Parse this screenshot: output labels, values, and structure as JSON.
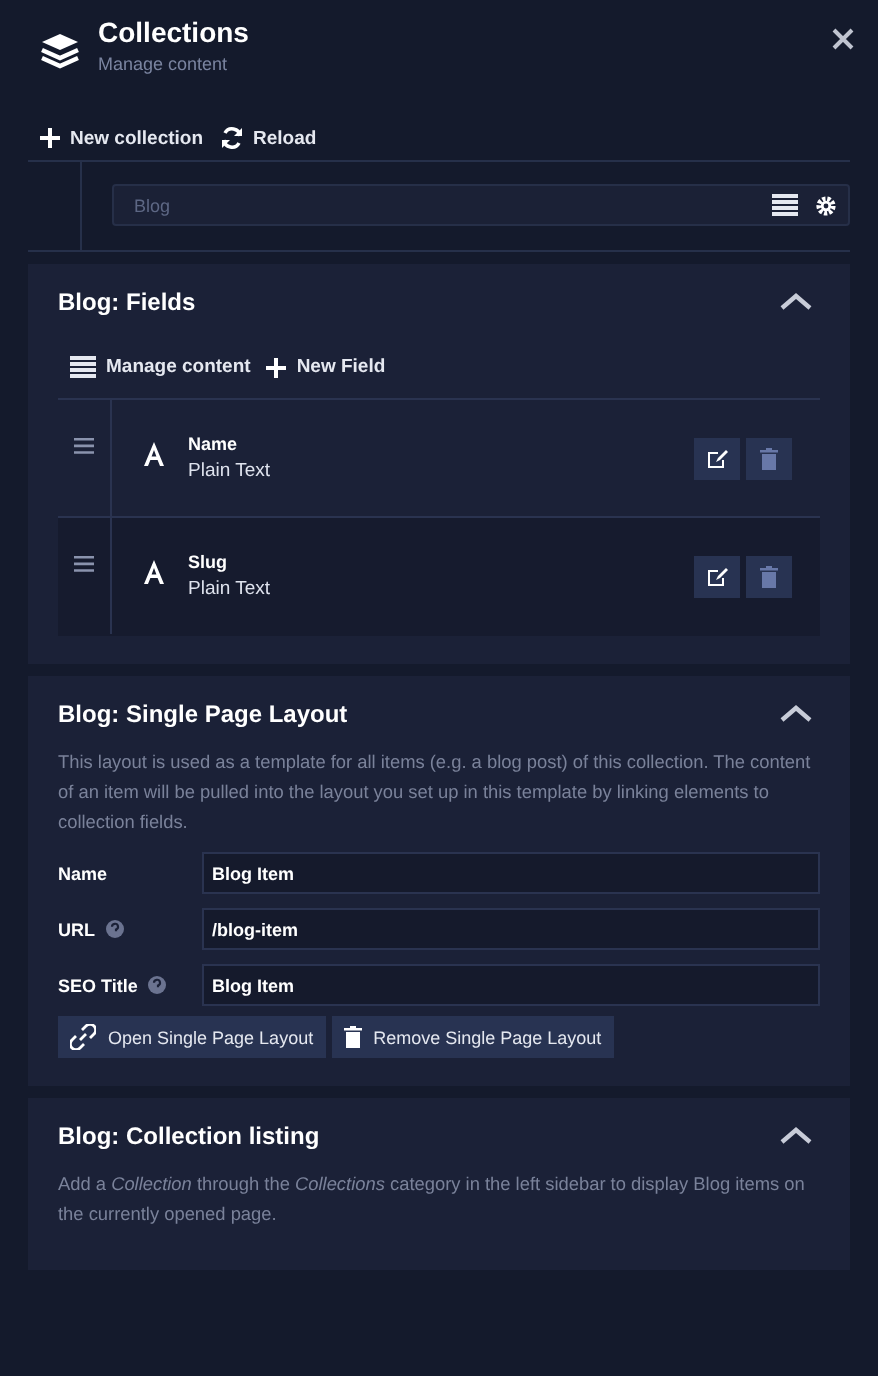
{
  "header": {
    "title": "Collections",
    "subtitle": "Manage content"
  },
  "toolbar": [
    "New collection",
    "Reload"
  ],
  "collection": {
    "placeholder": "Blog"
  },
  "sections": [
    {
      "kind": "fields",
      "title": "Blog: Fields",
      "expanded": true,
      "actions": [
        "Manage content",
        "New Field"
      ],
      "fields": [
        {
          "name": "Name",
          "type": "Plain Text"
        },
        {
          "name": "Slug",
          "type": "Plain Text"
        }
      ]
    },
    {
      "kind": "layout",
      "title": "Blog: Single Page Layout",
      "expanded": true,
      "description": "This layout is used as a template for all items (e.g. a blog post) of this collection. The content of an item will be pulled into the layout you set up in this template by linking elements to collection fields.",
      "form": [
        {
          "label": "Name",
          "help": false,
          "value": "Blog Item"
        },
        {
          "label": "URL",
          "help": true,
          "value": "/blog-item"
        },
        {
          "label": "SEO Title",
          "help": true,
          "value": "Blog Item"
        }
      ],
      "buttons": [
        "Open Single Page Layout",
        "Remove Single Page Layout"
      ]
    },
    {
      "kind": "listing",
      "title": "Blog: Collection listing",
      "expanded": true,
      "description": "Add a *Collection* through the *Collections* category in the left sidebar to display Blog items on the currently opened page."
    }
  ]
}
